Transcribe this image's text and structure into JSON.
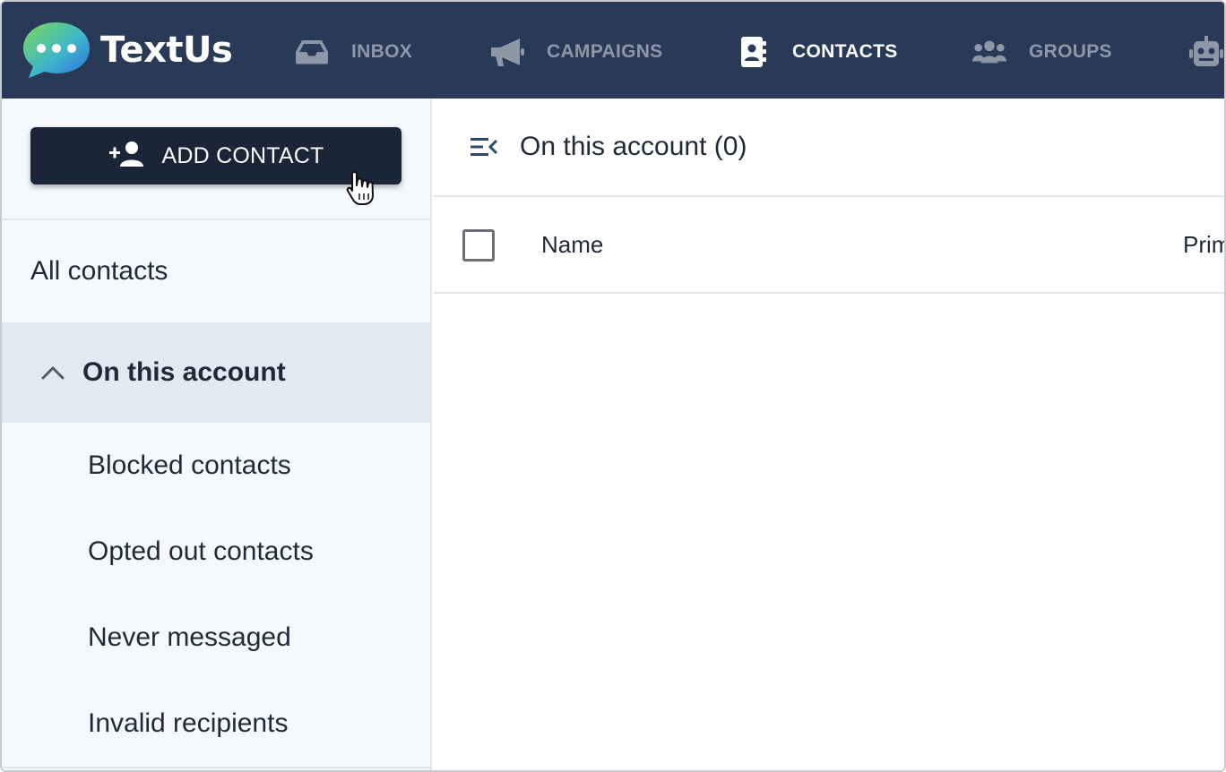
{
  "brand": {
    "name": "TextUs",
    "logo": "chat-bubble-logo"
  },
  "nav": {
    "items": [
      {
        "label": "INBOX",
        "icon": "inbox-icon",
        "active": false
      },
      {
        "label": "CAMPAIGNS",
        "icon": "megaphone-icon",
        "active": false
      },
      {
        "label": "CONTACTS",
        "icon": "contact-book-icon",
        "active": true
      },
      {
        "label": "GROUPS",
        "icon": "users-icon",
        "active": false
      },
      {
        "label": "",
        "icon": "robot-icon",
        "active": false
      }
    ]
  },
  "sidebar": {
    "add_contact_label": "ADD CONTACT",
    "items": [
      {
        "label": "All contacts"
      },
      {
        "label": "On this account",
        "expanded": true,
        "active": true
      },
      {
        "label": "Blocked contacts"
      },
      {
        "label": "Opted out contacts"
      },
      {
        "label": "Never messaged"
      },
      {
        "label": "Invalid recipients"
      }
    ]
  },
  "main": {
    "title": "On this account (0)",
    "columns": [
      {
        "label": "Name"
      },
      {
        "label": "Prim"
      }
    ]
  },
  "colors": {
    "topbar": "#283a58",
    "nav_inactive": "#8e97a6",
    "nav_active": "#ffffff",
    "button_dark": "#1b2538",
    "sidebar_bg": "#f5f9fd",
    "sidebar_active": "#e1eaf3"
  }
}
